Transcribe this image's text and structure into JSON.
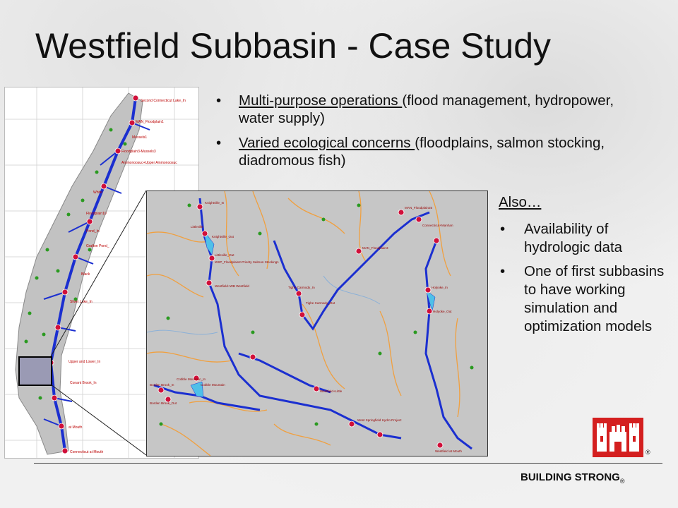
{
  "slide": {
    "title": "Westfield Subbasin - Case Study",
    "bullets": [
      {
        "underlined": "Multi-purpose operations ",
        "rest": "(flood management, hydropower, water supply)"
      },
      {
        "underlined": "Varied ecological concerns ",
        "rest": "(floodplains, salmon stocking, diadromous fish)"
      }
    ],
    "also": {
      "heading": "Also…",
      "items": [
        "Availability of hydrologic data",
        "One of first subbasins to have working simulation and optimization models"
      ]
    },
    "footer": {
      "text": "BUILDING STRONG",
      "mark": "®"
    },
    "logo_mark": "®"
  },
  "colors": {
    "river": "#1b2fd0",
    "node": "#d0103a",
    "tributary": "#f0a040",
    "site": "#2a9a20",
    "basin": "#c2c2c2"
  },
  "map_labels_left": [
    "Second Connecticut Lake_In",
    "MAN_Floodplain1",
    "Mussels1",
    "Floodplain3-Mussels3",
    "Ammonoosuc+Upper Ammonoosuc",
    "White",
    "Floodplain10",
    "Pond_In",
    "Grafton Pond_",
    "Black",
    "Sliver Lake_In",
    "Upper and Lower_In",
    "Conant Brook_In",
    "at Mouth",
    "Connecticut at Mouth"
  ],
  "map_labels_inset": [
    "Knightville_In",
    "Littleville",
    "Knightville_Out",
    "Littleville_Out",
    "WSP_Floodplain2-Priority Salmon Stocking1",
    "Westfield+WB Westfield",
    "Tighe Carmody_In",
    "Tighe Carmody_Out",
    "MAN_Floodplain25",
    "Connecticut+Manhan",
    "MAN_Floodplain3",
    "Holyoke_In",
    "Holyoke_Out",
    "Cobble Mountain_In",
    "Cobble Mountain",
    "Borden Brook_In",
    "Borden Brook_Out",
    "Westfield+Little",
    "West Springfield Hydro Project",
    "Westfield at Mouth"
  ]
}
